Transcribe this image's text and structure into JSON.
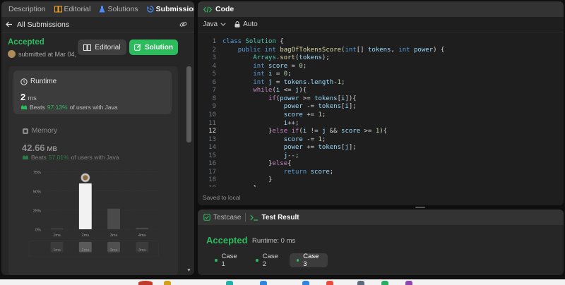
{
  "tabs": [
    {
      "label": "Description",
      "icon": "description-icon"
    },
    {
      "label": "Editorial",
      "icon": "book-icon"
    },
    {
      "label": "Solutions",
      "icon": "flask-icon"
    },
    {
      "label": "Submissions",
      "icon": "history-icon",
      "active": true
    }
  ],
  "subheader": {
    "back_label": "All Submissions"
  },
  "submission": {
    "status": "Accepted",
    "meta": "submitted at Mar 04,",
    "editorial_btn": "Editorial",
    "solution_btn": "Solution"
  },
  "runtime": {
    "title": "Runtime",
    "value": "2",
    "unit": "ms",
    "beats_prefix": "Beats",
    "beats_pct": "97.13%",
    "beats_suffix": "of users with Java"
  },
  "memory": {
    "title": "Memory",
    "value": "42.66",
    "unit": "MB",
    "beats_prefix": "Beats",
    "beats_pct": "57.01%",
    "beats_suffix": "of users with Java"
  },
  "chart_data": {
    "type": "bar",
    "categories": [
      "1ms",
      "2ms",
      "3ms",
      "4ms"
    ],
    "values": [
      1,
      60,
      27,
      2
    ],
    "highlight_index": 1,
    "ylim": [
      0,
      75
    ],
    "yticks": [
      "0%",
      "25%",
      "50%",
      "75%"
    ],
    "mini_categories": [
      "1ms",
      "2ms",
      "3ms",
      "4ms"
    ]
  },
  "code": {
    "title": "Code",
    "language": "Java",
    "autocomplete": "Auto",
    "saved_text": "Saved to local",
    "current_line": 12,
    "lines": [
      "class Solution {",
      "    public int bagOfTokensScore(int[] tokens, int power) {",
      "        Arrays.sort(tokens);",
      "        int score = 0;",
      "        int i = 0;",
      "        int j = tokens.length-1;",
      "        while(i <= j){",
      "            if(power >= tokens[i]){",
      "                power -= tokens[i];",
      "                score += 1;",
      "                i++;",
      "            }else if(i != j && score >= 1){",
      "                score -= 1;",
      "                power += tokens[j];",
      "                j--;",
      "            }else{",
      "                return score;",
      "            }",
      "        }"
    ]
  },
  "result": {
    "tabs": [
      {
        "label": "Testcase"
      },
      {
        "label": "Test Result",
        "active": true
      }
    ],
    "status": "Accepted",
    "runtime": "Runtime: 0 ms",
    "cases": [
      "Case 1",
      "Case 2",
      "Case 3"
    ],
    "active_case": 2
  },
  "colors": {
    "accent_green": "#2cbb5d",
    "panel": "#262626",
    "editor": "#1e1e1e"
  }
}
